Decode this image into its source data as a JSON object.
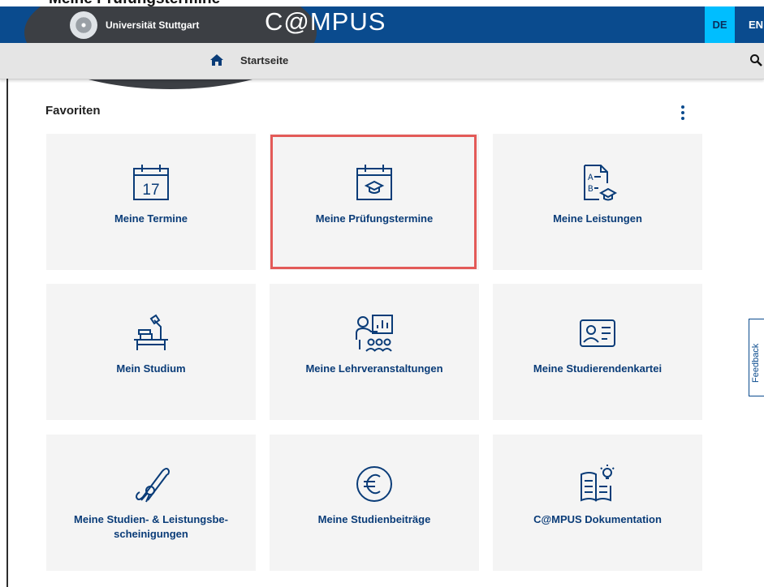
{
  "header": {
    "university": "Universität Stuttgart",
    "app_title": "C@MPUS",
    "lang_de": "DE",
    "lang_en": "EN"
  },
  "top_caption": "Meine Prüfungstermine",
  "breadcrumb": {
    "home_icon": "home-icon",
    "label": "Startseite",
    "search_icon": "search-icon"
  },
  "favorites": {
    "title": "Favoriten",
    "menu_icon": "more-vertical-icon",
    "tiles": [
      {
        "label": "Meine Termine",
        "icon": "calendar-17-icon",
        "calendar_day": "17"
      },
      {
        "label": "Meine Prüfungstermine",
        "icon": "calendar-graduation-cap-icon"
      },
      {
        "label": "Meine Leistungen",
        "icon": "grades-document-icon"
      },
      {
        "label": "Mein Studium",
        "icon": "study-desk-icon"
      },
      {
        "label": "Meine Lehrveranstaltungen",
        "icon": "lecture-presentation-icon"
      },
      {
        "label": "Meine Studierendenkartei",
        "icon": "student-id-card-icon"
      },
      {
        "label": "Meine Studien- & Leistungsbe-\nscheinigungen",
        "icon": "diploma-scroll-icon"
      },
      {
        "label": "Meine Studienbeiträge",
        "icon": "euro-icon"
      },
      {
        "label": "C@MPUS Dokumentation",
        "icon": "documentation-book-icon"
      }
    ]
  },
  "feedback": {
    "label": "Feedback"
  },
  "colors": {
    "header_blue": "#0a4b8e",
    "accent_cyan": "#00beff",
    "highlight_red": "#e35a58",
    "tile_bg": "#f4f4f4"
  }
}
